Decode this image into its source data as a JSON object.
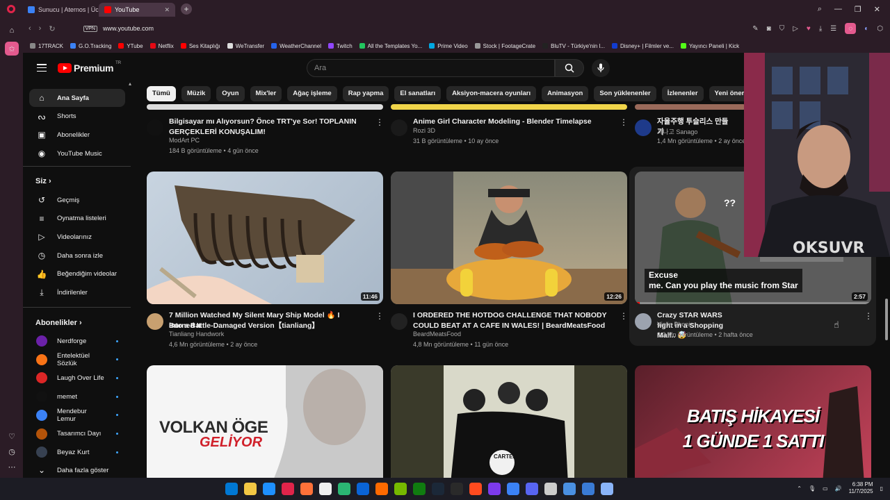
{
  "browser": {
    "tabs": [
      {
        "title": "Sunucu | Aternos | Ücretsi",
        "active": false,
        "favicon_color": "#3b82f6"
      },
      {
        "title": "YouTube",
        "active": true,
        "favicon_color": "#ff0000"
      }
    ],
    "url": "www.youtube.com",
    "vpn_label": "VPN",
    "bookmarks": [
      {
        "label": "17TRACK",
        "color": "#888888"
      },
      {
        "label": "G.O.Tracking",
        "color": "#3b82f6"
      },
      {
        "label": "YTube",
        "color": "#ff0000"
      },
      {
        "label": "Netflix",
        "color": "#e50914"
      },
      {
        "label": "Ses Kitaplığı",
        "color": "#ff0000"
      },
      {
        "label": "WeTransfer",
        "color": "#dddddd"
      },
      {
        "label": "WeatherChannel",
        "color": "#2563eb"
      },
      {
        "label": "Twitch",
        "color": "#9146ff"
      },
      {
        "label": "All the Templates Yo...",
        "color": "#22c55e"
      },
      {
        "label": "Prime Video",
        "color": "#00a8e1"
      },
      {
        "label": "Stock | FootageCrate",
        "color": "#999999"
      },
      {
        "label": "BluTV - Türkiye'nin l...",
        "color": "#222222"
      },
      {
        "label": "Disney+ | Filmler ve...",
        "color": "#113ccf"
      },
      {
        "label": "Yayıncı Paneli | Kick",
        "color": "#53fc18"
      }
    ]
  },
  "youtube": {
    "logo_text": "Premium",
    "logo_sup": "TR",
    "search_placeholder": "Ara",
    "chips": [
      "Tümü",
      "Müzik",
      "Oyun",
      "Mix'ler",
      "Ağaç işleme",
      "Rap yapma",
      "El sanatları",
      "Aksiyon-macera oyunları",
      "Animasyon",
      "Son yüklenenler",
      "İzlenenler",
      "Yeni öneriler"
    ],
    "guide": {
      "main": [
        {
          "label": "Ana Sayfa",
          "icon": "home-icon",
          "glyph": "⌂"
        },
        {
          "label": "Shorts",
          "icon": "shorts-icon",
          "glyph": "ᔓ"
        },
        {
          "label": "Abonelikler",
          "icon": "subscriptions-icon",
          "glyph": "▣"
        },
        {
          "label": "YouTube Music",
          "icon": "music-icon",
          "glyph": "◉"
        }
      ],
      "you_header": "Siz",
      "you": [
        {
          "label": "Geçmiş",
          "icon": "history-icon",
          "glyph": "↺"
        },
        {
          "label": "Oynatma listeleri",
          "icon": "playlist-icon",
          "glyph": "≡"
        },
        {
          "label": "Videolarınız",
          "icon": "your-videos-icon",
          "glyph": "▷"
        },
        {
          "label": "Daha sonra izle",
          "icon": "watch-later-icon",
          "glyph": "◷"
        },
        {
          "label": "Beğendiğim videolar",
          "icon": "like-icon",
          "glyph": "👍"
        },
        {
          "label": "İndirilenler",
          "icon": "download-icon",
          "glyph": "⤓"
        }
      ],
      "subs_header": "Abonelikler",
      "subs": [
        {
          "label": "Nerdforge",
          "color": "#6b21a8"
        },
        {
          "label": "Entelektüel Sözlük",
          "color": "#f97316"
        },
        {
          "label": "Laugh Over Life",
          "color": "#dc2626"
        },
        {
          "label": "memet",
          "color": "#111111"
        },
        {
          "label": "Mendebur Lemur",
          "color": "#3b82f6"
        },
        {
          "label": "Tasarımcı Dayı",
          "color": "#b45309"
        },
        {
          "label": "Beyaz Kurt",
          "color": "#374151"
        }
      ],
      "show_more": "Daha fazla göster"
    },
    "row1": [
      {
        "title1": "Bilgisayar mı Alıyorsun? Önce TRT'ye Sor! TOPLANIN",
        "title2": "GERÇEKLERİ KONUŞALIM!",
        "channel": "ModArt PC",
        "meta": "184 B görüntüleme • 4 gün önce",
        "avatar": "#111111"
      },
      {
        "title1": "Anime Girl Character Modeling - Blender Timelapse",
        "title2": "",
        "channel": "Rozi 3D",
        "meta": "31 B görüntüleme • 10 ay önce",
        "avatar": "#1a1a1a"
      },
      {
        "title1": "자율주행 투슬리스 만들기",
        "title2": "",
        "channel": "사나고 Sanago",
        "meta": "1,4 Mn görüntüleme • 2 ay önce",
        "avatar": "#1e3a8a"
      }
    ],
    "row2": [
      {
        "title1": "7 Million Watched My Silent Mary Ship Model 🔥 I Burned It",
        "title2": "into a Battle-Damaged Version【tianliang】",
        "channel": "Tianliang Handwork",
        "meta": "4,6 Mn görüntüleme • 2 ay önce",
        "duration": "11:46",
        "avatar": "#c8a070"
      },
      {
        "title1": "I ORDERED THE HOTDOG CHALLENGE THAT NOBODY",
        "title2": "COULD BEAT AT A CAFE IN WALES! | BeardMeatsFood",
        "channel": "BeardMeatsFood",
        "meta": "4,8 Mn görüntüleme • 11 gün önce",
        "duration": "12:26",
        "avatar": "#222222"
      },
      {
        "title1": "Crazy STAR WARS fight in a Shopping Mall.. 🤯",
        "title2": "",
        "channel": "Violin Phonix",
        "meta": "3,3 Mn görüntüleme • 2 hafta önce",
        "duration": "2:57",
        "avatar": "#9ca3af",
        "caption1": "Excuse",
        "caption2": "me. Can you play the music from Star",
        "progress": 0.02
      }
    ],
    "row3": [
      {
        "thumb_text1": "VOLKAN ÖGE",
        "thumb_text2": "GELİYOR"
      },
      {
        "thumb_text1": "CARTEL",
        "thumb_text2": ""
      },
      {
        "thumb_text1": "BATIŞ HİKAYESİ",
        "thumb_text2": "1 GÜNDE 1 SATTI"
      }
    ]
  },
  "taskbar": {
    "time": "6:38 PM",
    "date": "11/7/2025"
  }
}
